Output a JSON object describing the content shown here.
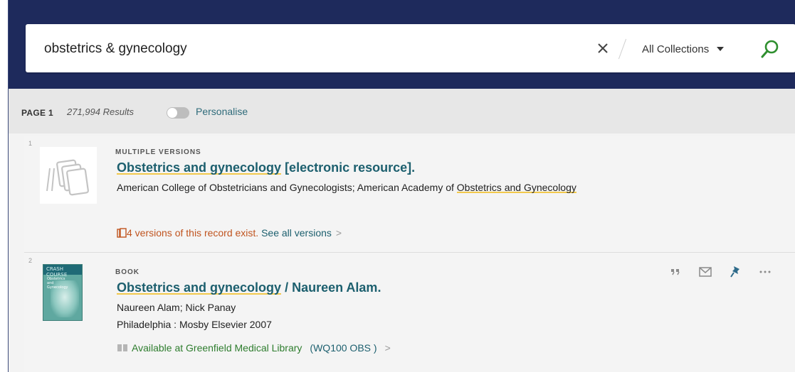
{
  "search": {
    "query": "obstetrics & gynecology",
    "scope": "All Collections"
  },
  "results": {
    "page_label": "PAGE 1",
    "count_text": "271,994 Results",
    "personalise_label": "Personalise",
    "personalise_on": false
  },
  "items": [
    {
      "rank": "1",
      "type": "MULTIPLE VERSIONS",
      "title_hl": "Obstetrics and gynecology",
      "title_rest": " [electronic resource].",
      "authors_pre": "American College of Obstetricians and Gynecologists; American Academy of ",
      "authors_hl": "Obstetrics and Gynecology",
      "versions_text": "4 versions of this record exist.",
      "see_all": "See all versions",
      "chevron": ">"
    },
    {
      "rank": "2",
      "type": "BOOK",
      "title_hl": "Obstetrics and gynecology",
      "title_rest": " / Naureen Alam.",
      "authors": "Naureen Alam; Nick Panay",
      "publication": "Philadelphia : Mosby Elsevier 2007",
      "availability": "Available at Greenfield Medical Library",
      "call_number": "(WQ100 OBS )",
      "chevron": ">",
      "cover_band": "CRASH COURSE",
      "cover_title": "Obstetrics and Gynecology"
    }
  ],
  "icons": {
    "clear": "close-icon",
    "dropdown": "caret-down-icon",
    "search": "magnifier-icon",
    "versions": "versions-stack-icon",
    "available": "book-open-icon",
    "cite": "quote-icon",
    "email": "envelope-icon",
    "pin": "pin-icon",
    "more": "ellipsis-icon"
  },
  "colors": {
    "topbar": "#1e2a5c",
    "link": "#1c5f6e",
    "highlight": "#f2c94c",
    "warning": "#c0541f",
    "available": "#2e7d2e",
    "search_icon": "#2f8f2f",
    "pin": "#2f6b8a"
  }
}
